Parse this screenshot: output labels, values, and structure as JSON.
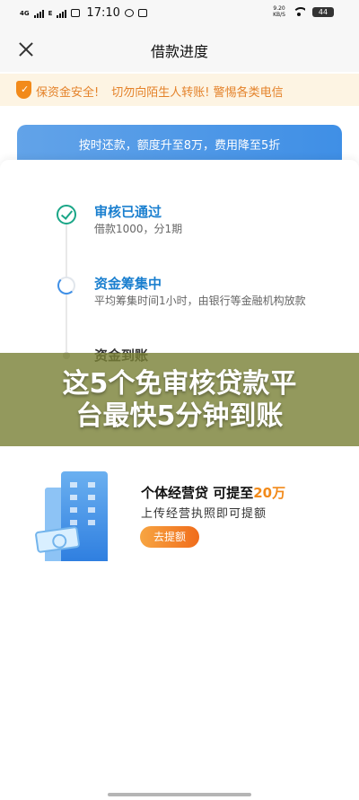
{
  "status_bar": {
    "network_1": "4G",
    "network_2": "E",
    "time": "17:10",
    "speed_value": "9.20",
    "speed_unit": "KB/S",
    "battery": "44"
  },
  "header": {
    "title": "借款进度"
  },
  "notice": {
    "text_1": "保资金安全!",
    "text_2": "切勿向陌生人转账! 警惕各类电信"
  },
  "banner": {
    "text": "按时还款，额度升至8万，费用降至5折"
  },
  "steps": [
    {
      "title": "审核已通过",
      "desc": "借款1000，分1期",
      "status": "done"
    },
    {
      "title": "资金筹集中",
      "desc": "平均筹集时间1小时，由银行等金融机构放款",
      "status": "in-progress"
    },
    {
      "title": "资金到账",
      "desc": "",
      "status": "pending"
    }
  ],
  "overlay": {
    "line_1": "这5个免审核贷款平",
    "line_2": "台最快5分钟到账"
  },
  "promo": {
    "title_prefix": "个体经营贷  可提至",
    "amount": "20万",
    "desc": "上传经营执照即可提额",
    "button": "去提额"
  },
  "colors": {
    "accent_blue": "#3f8fe6",
    "success_green": "#1aa687",
    "warning_orange": "#f28a1a",
    "notice_bg": "#fdf4e3"
  }
}
